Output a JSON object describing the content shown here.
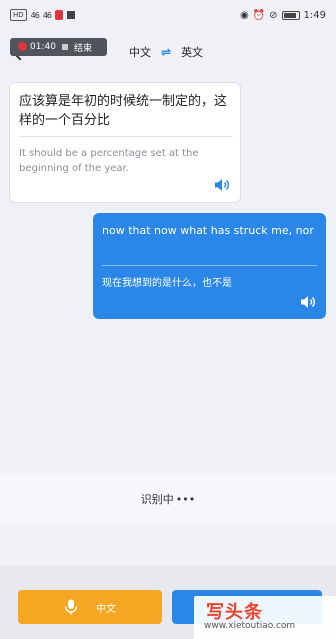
{
  "status_bar": {
    "hd_label": "HD",
    "signal_1": "46",
    "signal_2": "46",
    "time": "1:49"
  },
  "recording": {
    "duration": "01:40",
    "end_label": "结束"
  },
  "languages": {
    "source": "中文",
    "target": "英文"
  },
  "messages": [
    {
      "source_text": "应该算是年初的时候统一制定的，这样的一个百分比",
      "translation": "It should be a percentage set at the beginning of the year."
    },
    {
      "source_text": "now that now what has struck me, nor",
      "translation": "现在我想到的是什么，也不是"
    }
  ],
  "recognizing_label": "识别中",
  "recognizing_dots": "•••",
  "buttons": {
    "chinese_label": "中文"
  },
  "watermark": {
    "main": "写头条",
    "url": "www.xietoutiao.com"
  },
  "colors": {
    "accent_blue": "#2a87e8",
    "accent_orange": "#f5a623",
    "record_red": "#e2343c"
  }
}
